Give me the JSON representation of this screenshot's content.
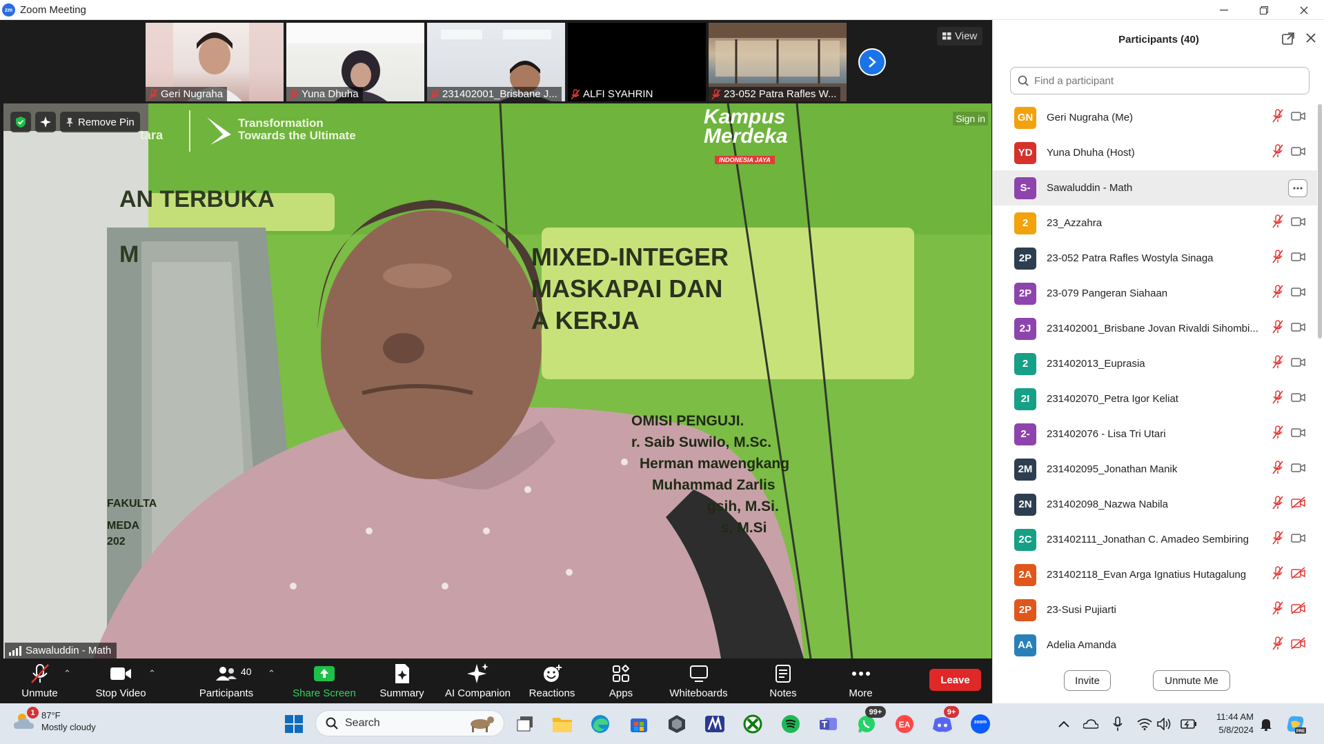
{
  "window": {
    "app_icon": "zm",
    "title": "Zoom Meeting",
    "controls": [
      "minimize-icon",
      "maximize-icon",
      "close-icon"
    ]
  },
  "thumbnails": [
    {
      "name": "Geri Nugraha",
      "muted": true
    },
    {
      "name": "Yuna Dhuha",
      "muted": true
    },
    {
      "name": "231402001_Brisbane J...",
      "muted": true
    },
    {
      "name": "ALFI SYAHRIN",
      "muted": true
    },
    {
      "name": "23-052 Patra Rafles W...",
      "muted": true
    }
  ],
  "view_button": {
    "label": "View"
  },
  "main_video": {
    "speaker": "Sawaluddin - Math",
    "remove_pin_label": "Remove Pin",
    "sign_in_label": "Sign in",
    "banner": {
      "tagline_1": "Transformation",
      "tagline_2": "Towards the Ultimate",
      "brand_left": "tara",
      "logo_line_1": "Kampus",
      "logo_line_2": "Merdeka",
      "logo_line_3": "INDONESIA JAYA",
      "heading": "AN TERBUKA",
      "title_1": "MIXED-INTEGER",
      "title_2": "MASKAPAI  DAN",
      "title_3": "A KERJA",
      "title_left": "M",
      "committee": "OMISI PENGUJI.",
      "members": [
        "r. Saib Suwilo, M.Sc.",
        "Herman mawengkang",
        "Muhammad Zarlis",
        "gsih, M.Si.",
        "s, M.Si"
      ],
      "faculty": "FAKULTA",
      "city": "MEDA",
      "year": "202"
    }
  },
  "toolbar": {
    "unmute": "Unmute",
    "stop_video": "Stop Video",
    "participants": "Participants",
    "participants_count": "40",
    "share_screen": "Share Screen",
    "summary": "Summary",
    "ai_companion": "AI Companion",
    "reactions": "Reactions",
    "apps": "Apps",
    "whiteboards": "Whiteboards",
    "notes": "Notes",
    "more": "More",
    "leave": "Leave"
  },
  "participants_panel": {
    "title": "Participants (40)",
    "search_placeholder": "Find a participant",
    "participants": [
      {
        "initials": "GN",
        "name": "Geri Nugraha (Me)",
        "color": "#f2a20c",
        "mic_muted": true,
        "video_off": false
      },
      {
        "initials": "YD",
        "name": "Yuna Dhuha (Host)",
        "color": "#d6312b",
        "mic_muted": true,
        "video_off": false
      },
      {
        "initials": "S-",
        "name": "Sawaluddin - Math",
        "color": "#8e44ad",
        "mic_muted": false,
        "video_off": false,
        "hover": true
      },
      {
        "initials": "2",
        "name": "23_Azzahra",
        "color": "#f2a20c",
        "mic_muted": true,
        "video_off": false
      },
      {
        "initials": "2P",
        "name": "23-052 Patra Rafles Wostyla Sinaga",
        "color": "#2c3e50",
        "mic_muted": true,
        "video_off": false
      },
      {
        "initials": "2P",
        "name": "23-079 Pangeran Siahaan",
        "color": "#8e44ad",
        "mic_muted": true,
        "video_off": false
      },
      {
        "initials": "2J",
        "name": "231402001_Brisbane Jovan Rivaldi Sihombi...",
        "color": "#8e44ad",
        "mic_muted": true,
        "video_off": false
      },
      {
        "initials": "2",
        "name": "231402013_Euprasia",
        "color": "#16a085",
        "mic_muted": true,
        "video_off": false
      },
      {
        "initials": "2I",
        "name": "231402070_Petra Igor Keliat",
        "color": "#16a085",
        "mic_muted": true,
        "video_off": false
      },
      {
        "initials": "2-",
        "name": "231402076 - Lisa Tri Utari",
        "color": "#8e44ad",
        "mic_muted": true,
        "video_off": false
      },
      {
        "initials": "2M",
        "name": "231402095_Jonathan Manik",
        "color": "#2c3e50",
        "mic_muted": true,
        "video_off": false
      },
      {
        "initials": "2N",
        "name": "231402098_Nazwa Nabila",
        "color": "#2c3e50",
        "mic_muted": true,
        "video_off": true
      },
      {
        "initials": "2C",
        "name": "231402111_Jonathan C. Amadeo Sembiring",
        "color": "#16a085",
        "mic_muted": true,
        "video_off": false
      },
      {
        "initials": "2A",
        "name": "231402118_Evan Arga Ignatius Hutagalung",
        "color": "#e0561b",
        "mic_muted": true,
        "video_off": true
      },
      {
        "initials": "2P",
        "name": "23-Susi Pujiarti",
        "color": "#e0561b",
        "mic_muted": true,
        "video_off": true
      },
      {
        "initials": "AA",
        "name": "Adelia Amanda",
        "color": "#2980b9",
        "mic_muted": true,
        "video_off": true
      }
    ],
    "invite_label": "Invite",
    "unmute_me_label": "Unmute Me"
  },
  "taskbar": {
    "weather_badge": "1",
    "temperature": "87°F",
    "condition": "Mostly cloudy",
    "search_label": "Search",
    "whatsapp_badge": "99+",
    "discord_badge": "9+",
    "zoom_label": "zoom",
    "time": "11:44 AM",
    "date": "5/8/2024"
  }
}
